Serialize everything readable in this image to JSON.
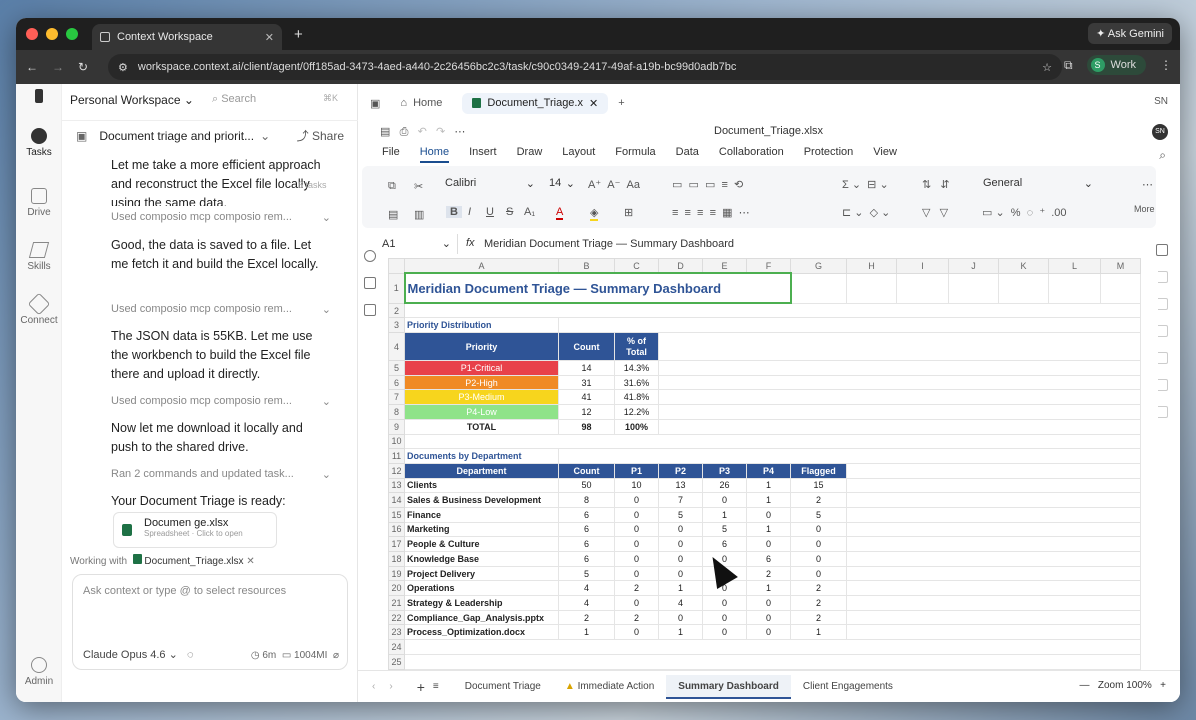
{
  "browser": {
    "tab_title": "Context Workspace",
    "url": "workspace.context.ai/client/agent/0ff185ad-3473-4aed-a440-2c26456bc2c3/task/c90c0349-2417-49af-a19b-bc99d0adb7bc",
    "gemini": "Ask Gemini",
    "profile_initial": "S",
    "profile": "Work"
  },
  "rail": [
    {
      "label": "Tasks"
    },
    {
      "label": "Drive"
    },
    {
      "label": "Skills"
    },
    {
      "label": "Connect"
    },
    {
      "label": "Admin"
    }
  ],
  "workspace": {
    "name": "Personal Workspace",
    "search": "Search",
    "shortcut": "⌘K"
  },
  "thread": {
    "title": "Document triage and priorit...",
    "share": "Share"
  },
  "messages": {
    "m1": "Let me take a more efficient approach and reconstruct the Excel file locally using the same data.",
    "tasks_badge": "6 tasks",
    "t1": "Used composio mcp composio rem...",
    "m2": "Good, the data is saved to a file. Let me fetch it and build the Excel locally.",
    "t2": "Used composio mcp composio rem...",
    "m3": "The JSON data is 55KB. Let me use the workbench to build the Excel file there and upload it directly.",
    "t3": "Used composio mcp composio rem...",
    "m4": "Now let me download it locally and push to the shared drive.",
    "t4": "Ran 2 commands and updated task...",
    "m5": "Your Document Triage is ready:"
  },
  "filecard": {
    "name": "Documen   ge.xlsx",
    "sub": "Spreadsheet · Click to open"
  },
  "working": {
    "label": "Working with",
    "file": "Document_Triage.xlsx"
  },
  "input": {
    "placeholder": "Ask context or type @ to select resources",
    "model": "Claude Opus 4.6",
    "time": "6m",
    "tokens": "1004MI"
  },
  "doctabs": {
    "home": "Home",
    "file": "Document_Triage.x",
    "user": "SN"
  },
  "sheet": {
    "filename": "Document_Triage.xlsx",
    "menu": [
      "File",
      "Home",
      "Insert",
      "Draw",
      "Layout",
      "Formula",
      "Data",
      "Collaboration",
      "Protection",
      "View"
    ],
    "font": "Calibri",
    "size": "14",
    "format": "General",
    "more": "More",
    "cellref": "A1",
    "formula": "Meridian Document Triage — Summary Dashboard",
    "cols": [
      "A",
      "B",
      "C",
      "D",
      "E",
      "F",
      "G",
      "H",
      "I",
      "J",
      "K",
      "L",
      "M"
    ],
    "title": "Meridian Document Triage — Summary Dashboard",
    "prio_section": "Priority Distribution",
    "prio_head": [
      "Priority",
      "Count",
      "% of Total"
    ],
    "prio_rows": [
      {
        "name": "P1-Critical",
        "count": "14",
        "pct": "14.3%",
        "color": "#e8414a"
      },
      {
        "name": "P2-High",
        "count": "31",
        "pct": "31.6%",
        "color": "#f08a24"
      },
      {
        "name": "P3-Medium",
        "count": "41",
        "pct": "41.8%",
        "color": "#f7d51d"
      },
      {
        "name": "P4-Low",
        "count": "12",
        "pct": "12.2%",
        "color": "#8fe389"
      }
    ],
    "prio_total": [
      "TOTAL",
      "98",
      "100%"
    ],
    "dept_section": "Documents by Department",
    "dept_head": [
      "Department",
      "Count",
      "P1",
      "P2",
      "P3",
      "P4",
      "Flagged"
    ],
    "dept_rows": [
      [
        "Clients",
        "50",
        "10",
        "13",
        "26",
        "1",
        "15"
      ],
      [
        "Sales & Business Development",
        "8",
        "0",
        "7",
        "0",
        "1",
        "2"
      ],
      [
        "Finance",
        "6",
        "0",
        "5",
        "1",
        "0",
        "5"
      ],
      [
        "Marketing",
        "6",
        "0",
        "0",
        "5",
        "1",
        "0"
      ],
      [
        "People & Culture",
        "6",
        "0",
        "0",
        "6",
        "0",
        "0"
      ],
      [
        "Knowledge Base",
        "6",
        "0",
        "0",
        "0",
        "6",
        "0"
      ],
      [
        "Project Delivery",
        "5",
        "0",
        "0",
        "3",
        "2",
        "0"
      ],
      [
        "Operations",
        "4",
        "2",
        "1",
        "0",
        "1",
        "2"
      ],
      [
        "Strategy & Leadership",
        "4",
        "0",
        "4",
        "0",
        "0",
        "2"
      ],
      [
        "Compliance_Gap_Analysis.pptx",
        "2",
        "2",
        "0",
        "0",
        "0",
        "2"
      ],
      [
        "Process_Optimization.docx",
        "1",
        "0",
        "1",
        "0",
        "0",
        "1"
      ]
    ],
    "tabs": [
      "Document Triage",
      "Immediate Action",
      "Summary Dashboard",
      "Client Engagements"
    ],
    "zoom": "Zoom 100%"
  }
}
